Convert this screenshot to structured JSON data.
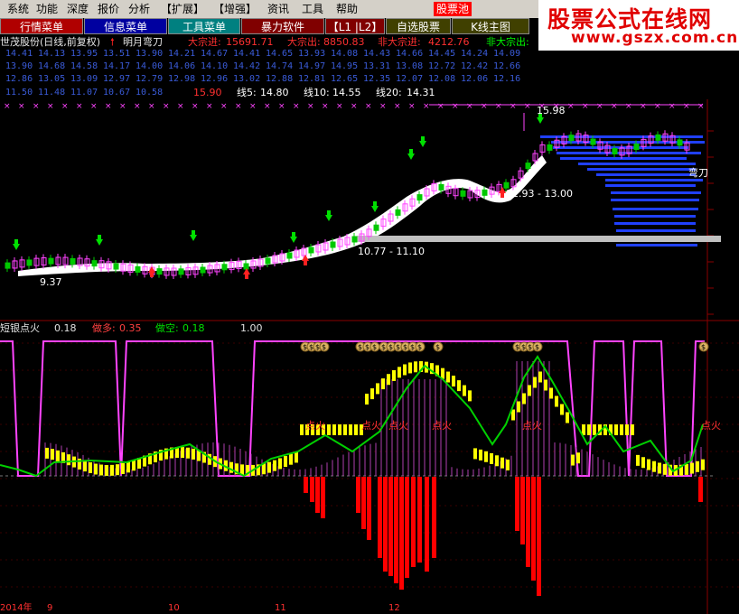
{
  "menubar": {
    "items": [
      "系统",
      "功能",
      "深度",
      "报价",
      "分析",
      "【扩展】",
      "【增强】",
      "资讯",
      "工具",
      "帮助"
    ],
    "highlight": "股票池"
  },
  "tabs": [
    "行情菜单",
    "信息菜单",
    "工具菜单",
    "暴力软件",
    "【L1 |L2】",
    "自选股票",
    "K线主图"
  ],
  "brand": {
    "name": "股票公式在线网",
    "url": "www.gszx.com.cn"
  },
  "header": {
    "stock": "世茂股份(日线,前复权)",
    "indicator": "明月弯刀",
    "big_in_label": "大宗进:",
    "big_in": "15691.71",
    "big_out_label": "大宗出:",
    "big_out": "8850.83",
    "nonbig_in_label": "非大宗进:",
    "nonbig_in": "4212.76",
    "nonbig_out_label": "非大宗出:"
  },
  "number_grid": [
    [
      "14.41",
      "14.13",
      "13.95",
      "13.51",
      "13.90",
      "14.21",
      "14.67",
      "14.41",
      "14.65",
      "13.93",
      "14.08",
      "14.43",
      "14.66",
      "14.45",
      "14.24",
      "14.09"
    ],
    [
      "13.90",
      "14.68",
      "14.58",
      "14.17",
      "14.00",
      "14.06",
      "14.10",
      "14.42",
      "14.74",
      "14.97",
      "14.95",
      "13.31",
      "13.08",
      "12.72",
      "12.42",
      "12.66"
    ],
    [
      "12.86",
      "13.05",
      "13.09",
      "12.97",
      "12.79",
      "12.98",
      "12.96",
      "13.02",
      "12.88",
      "12.81",
      "12.65",
      "12.35",
      "12.07",
      "12.08",
      "12.06",
      "12.16"
    ],
    [
      "11.50",
      "11.48",
      "11.07",
      "10.67",
      "10.58"
    ]
  ],
  "price_now": "15.90",
  "ma": [
    {
      "label": "线5:",
      "value": "14.80"
    },
    {
      "label": "线10:",
      "value": "14.55"
    },
    {
      "label": "线20:",
      "value": "14.31"
    }
  ],
  "annotations": {
    "high": "15.98",
    "range_mid": "12.93 - 13.00",
    "range_low": "10.77 - 11.10",
    "low": "9.37",
    "blade": "弯刀"
  },
  "sub": {
    "name": "短银点火",
    "v0": "0.18",
    "long_label": "做多:",
    "long": "0.35",
    "short_label": "做空:",
    "short": "0.18",
    "v3": "1.00",
    "fire": "点火",
    "coin": "$"
  },
  "xaxis": [
    "2014年",
    "9",
    "10",
    "11",
    "12"
  ],
  "colors": {
    "up": "#ff3b3b",
    "down": "#00c800",
    "magenta": "#ff44ff",
    "yellow": "#ffff00",
    "green": "#00d000",
    "blue": "#2040ff",
    "red": "#ff0000",
    "text": "#c0c0c0"
  }
}
